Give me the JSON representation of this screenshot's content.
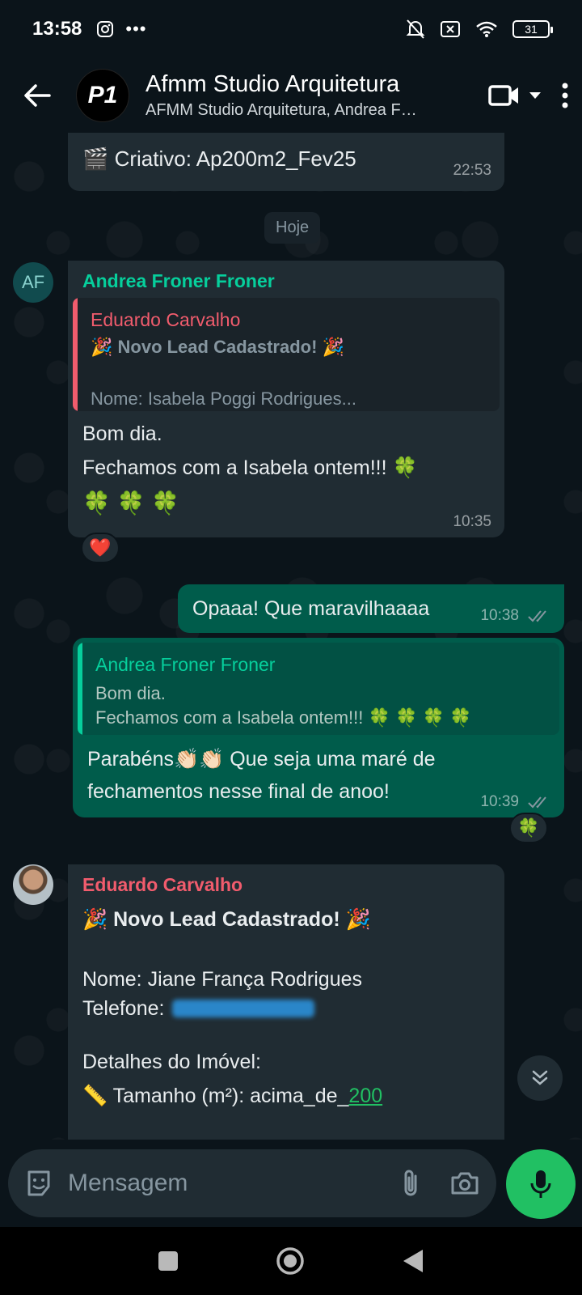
{
  "status_bar": {
    "time": "13:58",
    "battery": "31"
  },
  "header": {
    "avatar_text": "P1",
    "title": "Afmm Studio Arquitetura",
    "subtitle": "AFMM Studio Arquitetura, Andrea Froner Froner"
  },
  "messages": {
    "m1": {
      "text": "🎬 Criativo: Ap200m2_Fev25",
      "time": "22:53"
    },
    "date_chip": "Hoje",
    "m2": {
      "avatar": "AF",
      "sender": "Andrea Froner Froner",
      "quote_sender": "Eduardo Carvalho",
      "quote_line1": "🎉 Novo Lead Cadastrado! 🎉",
      "quote_line2": "Nome: Isabela Poggi Rodrigues...",
      "line1": "Bom dia.",
      "line2": "Fechamos com a Isabela ontem!!! 🍀",
      "line3": "🍀 🍀 🍀",
      "time": "10:35",
      "reaction": "❤️"
    },
    "m3": {
      "text": "Opaaa! Que maravilhaaaa",
      "time": "10:38"
    },
    "m4": {
      "quote_sender": "Andrea Froner Froner",
      "quote_line1": "Bom dia.",
      "quote_line2": "Fechamos com a Isabela ontem!!! 🍀 🍀 🍀 🍀",
      "line1": "Parabéns👏🏻👏🏻 Que seja uma maré de",
      "line2": "fechamentos nesse final de anoo!",
      "time": "10:39",
      "reaction": "🍀"
    },
    "m5": {
      "sender": "Eduardo Carvalho",
      "title": "🎉 Novo Lead Cadastrado! 🎉",
      "nome": "Nome: Jiane França Rodrigues",
      "telefone_label": "Telefone:",
      "detalhes": "Detalhes do Imóvel:",
      "tamanho_prefix": "📏 Tamanho (m²): acima_de_",
      "tamanho_link": "200"
    }
  },
  "input": {
    "placeholder": "Mensagem"
  },
  "colors": {
    "accent": "#21c063",
    "incoming": "#202c33",
    "outgoing": "#005c4b",
    "bg": "#0b141a"
  }
}
